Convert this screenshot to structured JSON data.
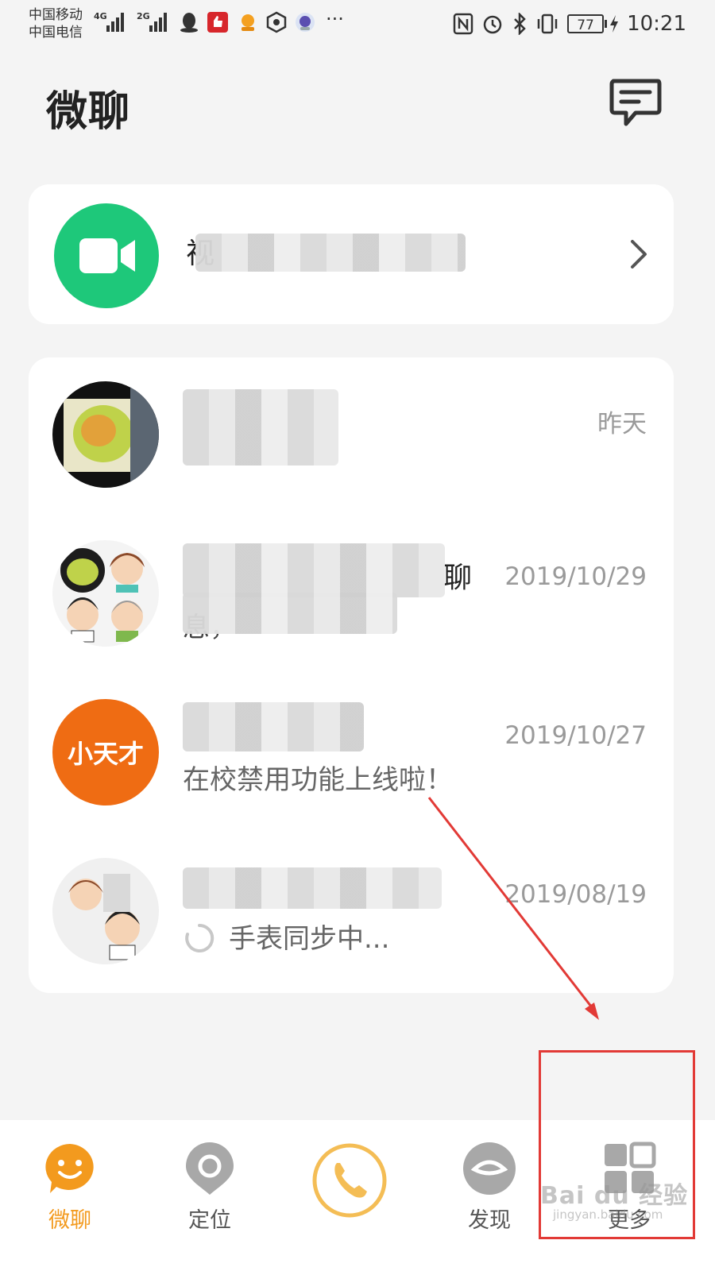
{
  "status_bar": {
    "carrier_1": "中国移动",
    "carrier_2": "中国电信",
    "net_1": "4G",
    "net_2": "2G",
    "more": "···",
    "battery": "77",
    "time": "10:21"
  },
  "header": {
    "title": "微聊"
  },
  "video_card": {
    "label": "视"
  },
  "chats": [
    {
      "name": "",
      "preview": "",
      "time": "昨天"
    },
    {
      "name": "聊",
      "preview": "息，",
      "time": "2019/10/29"
    },
    {
      "name": "",
      "preview": "在校禁用功能上线啦！",
      "time": "2019/10/27",
      "avatar_text": "小天才"
    },
    {
      "name": "",
      "preview": "手表同步中...",
      "time": "2019/08/19"
    }
  ],
  "bottom_nav": {
    "items": [
      {
        "label": "微聊",
        "active": true
      },
      {
        "label": "定位",
        "active": false
      },
      {
        "label": "",
        "active": false
      },
      {
        "label": "发现",
        "active": false
      },
      {
        "label": "更多",
        "active": false
      }
    ]
  },
  "watermark": {
    "text": "Bai du 经验",
    "url": "jingyan.baidu.com"
  },
  "colors": {
    "accent": "#f39a1e",
    "video_green": "#1ec87a",
    "brand_orange": "#ef6c13",
    "annotation_red": "#e23a36",
    "nav_gray": "#a8a8a8"
  }
}
